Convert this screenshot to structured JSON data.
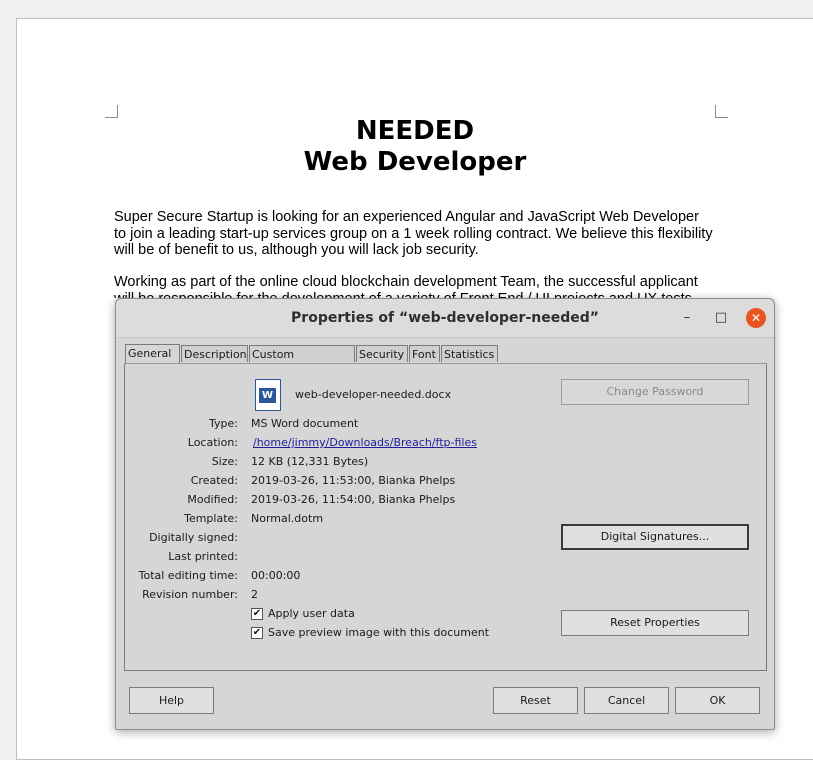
{
  "document": {
    "title_line1": "NEEDED",
    "title_line2": "Web Developer",
    "paragraph1": "Super Secure Startup is looking for an experienced Angular and JavaScript Web Developer to join a leading start-up services group on a 1 week rolling contract. We believe this flexibility will be of benefit to us, although you will lack job security.",
    "paragraph2": "Working as part of the online cloud blockchain development Team, the successful applicant will be responsible for the development of a variety of Front End / UI projects and UX tests, and"
  },
  "dialog": {
    "title": "Properties of “web-developer-needed”",
    "window_buttons": {
      "minimize": "–",
      "maximize": "□",
      "close": "✕"
    },
    "tabs": [
      "General",
      "Description",
      "Custom Properties",
      "Security",
      "Font",
      "Statistics"
    ],
    "active_tab": "General",
    "file_icon": "word-document-icon",
    "filename": "web-developer-needed.docx",
    "fields": {
      "type_label": "Type:",
      "type_value": "MS Word document",
      "location_label": "Location:",
      "location_value": "/home/jimmy/Downloads/Breach/ftp-files",
      "size_label": "Size:",
      "size_value": "12 KB (12,331 Bytes)",
      "created_label": "Created:",
      "created_value": "2019-03-26, 11:53:00, Bianka Phelps",
      "modified_label": "Modified:",
      "modified_value": "2019-03-26, 11:54:00, Bianka Phelps",
      "template_label": "Template:",
      "template_value": "Normal.dotm",
      "signed_label": "Digitally signed:",
      "signed_value": "",
      "printed_label": "Last printed:",
      "printed_value": "",
      "editing_label": "Total editing time:",
      "editing_value": "00:00:00",
      "revision_label": "Revision number:",
      "revision_value": "2"
    },
    "checkboxes": {
      "apply_user_data": "Apply user data",
      "save_preview": "Save preview image with this document",
      "checkmark": "✔"
    },
    "buttons": {
      "change_password": "Change Password",
      "digital_signatures": "Digital Signatures...",
      "reset_properties": "Reset Properties",
      "help": "Help",
      "reset": "Reset",
      "cancel": "Cancel",
      "ok": "OK"
    },
    "colors": {
      "close_button": "#e95420",
      "link": "#1f1f9e",
      "file_icon": "#2b579a"
    }
  }
}
